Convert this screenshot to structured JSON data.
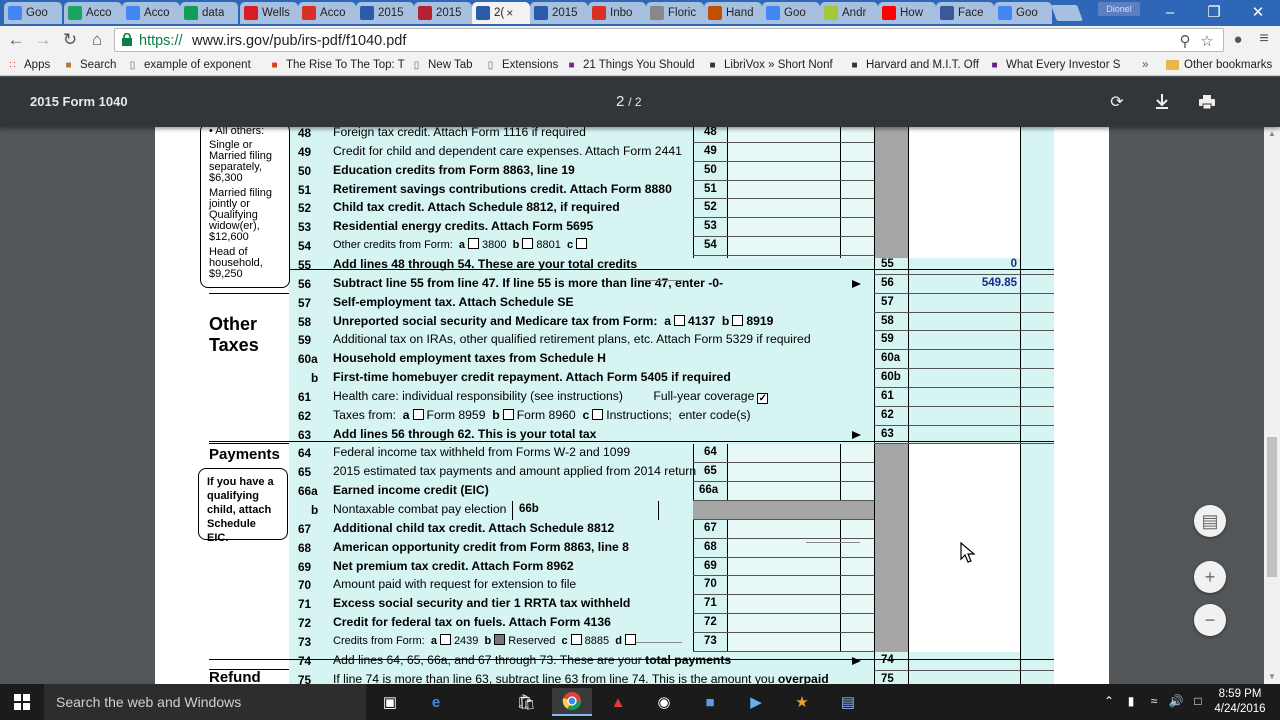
{
  "browser": {
    "tabs": [
      {
        "label": "Goo",
        "icon": "google-icon",
        "color": "#4285f4"
      },
      {
        "label": "Acco",
        "icon": "drive-icon",
        "color": "#1da462"
      },
      {
        "label": "Acco",
        "icon": "docs-icon",
        "color": "#4285f4"
      },
      {
        "label": "data",
        "icon": "sheets-icon",
        "color": "#0f9d58"
      },
      {
        "label": "Wells",
        "icon": "wellsfargo-icon",
        "color": "#d71e28"
      },
      {
        "label": "Acco",
        "icon": "pdf-icon",
        "color": "#d93025"
      },
      {
        "label": "2015",
        "icon": "irs-icon",
        "color": "#2a5bab"
      },
      {
        "label": "2015",
        "icon": "flag-icon",
        "color": "#b22234"
      },
      {
        "label": "2(",
        "icon": "irs-icon",
        "color": "#2a5bab",
        "active": true
      },
      {
        "label": "2015",
        "icon": "irs-icon",
        "color": "#2a5bab"
      },
      {
        "label": "Inbo",
        "icon": "gmail-icon",
        "color": "#d93025"
      },
      {
        "label": "Floric",
        "icon": "page-icon",
        "color": "#888888"
      },
      {
        "label": "Hand",
        "icon": "site-icon",
        "color": "#c05000"
      },
      {
        "label": "Goo",
        "icon": "google-icon",
        "color": "#4285f4"
      },
      {
        "label": "Andr",
        "icon": "android-icon",
        "color": "#a4c639"
      },
      {
        "label": "How",
        "icon": "youtube-icon",
        "color": "#ff0000"
      },
      {
        "label": "Face",
        "icon": "facebook-icon",
        "color": "#3b5998"
      },
      {
        "label": "Goo",
        "icon": "google-icon",
        "color": "#4285f4"
      }
    ],
    "active_tab_close": "×",
    "user_chip": "Dionel",
    "url_scheme": "https://",
    "url_rest": "www.irs.gov/pub/irs-pdf/f1040.pdf",
    "bookmarks": [
      {
        "label": "Apps",
        "icon": "apps-icon"
      },
      {
        "label": "Search",
        "icon": "search-bm-icon"
      },
      {
        "label": "example of exponent",
        "icon": "page-icon"
      },
      {
        "label": "The Rise To The Top: T",
        "icon": "rise-icon"
      },
      {
        "label": "New Tab",
        "icon": "page-icon"
      },
      {
        "label": "Extensions",
        "icon": "page-icon"
      },
      {
        "label": "21 Things You Should",
        "icon": "yahoo-icon"
      },
      {
        "label": "LibriVox » Short Nonf",
        "icon": "librivox-icon"
      },
      {
        "label": "Harvard and M.I.T. Off",
        "icon": "harvard-icon"
      },
      {
        "label": "What Every Investor S",
        "icon": "investor-icon"
      }
    ],
    "bookmarks_overflow": "»",
    "other_bookmarks": "Other bookmarks"
  },
  "pdf": {
    "title": "2015 Form 1040",
    "page_current": "2",
    "page_total": "2"
  },
  "form": {
    "sidebox_std": {
      "all_others": "• All others:",
      "single": "Single or Married filing separately, $6,300",
      "married": "Married filing jointly or Qualifying widow(er), $12,600",
      "head": "Head of household, $9,250"
    },
    "section_other_taxes": "Other Taxes",
    "section_payments": "Payments",
    "section_refund": "Refund",
    "sidebox_eic": "If you have a qualifying child, attach Schedule EIC.",
    "lines": [
      {
        "n": "48",
        "text": "Foreign tax credit. Attach Form 1116 if required",
        "box": "48"
      },
      {
        "n": "49",
        "text": "Credit for child and dependent care expenses. Attach Form 2441",
        "box": "49"
      },
      {
        "n": "50",
        "text": "Education credits from Form 8863, line 19",
        "box": "50"
      },
      {
        "n": "51",
        "text": "Retirement savings contributions credit. Attach Form 8880",
        "box": "51"
      },
      {
        "n": "52",
        "text": "Child tax credit. Attach Schedule 8812, if required",
        "box": "52"
      },
      {
        "n": "53",
        "text": "Residential energy credits. Attach Form 5695",
        "box": "53"
      },
      {
        "n": "54",
        "text": "Other credits from Form:",
        "a": "a",
        "a_val": "3800",
        "b": "b",
        "b_val": "8801",
        "c": "c",
        "box": "54"
      },
      {
        "n": "55",
        "text": "Add lines 48 through 54. These are your ",
        "bold": "total credits",
        "box": "55",
        "value": "0"
      },
      {
        "n": "56",
        "text": "Subtract line 55 from line 47. If line 55 is more than line 47, enter -0-",
        "box": "56",
        "value": "549.85"
      },
      {
        "n": "57",
        "text": "Self-employment tax. Attach Schedule SE",
        "box": "57"
      },
      {
        "n": "58",
        "text": "Unreported social security and Medicare tax from Form:",
        "a": "a",
        "a_val": "4137",
        "b": "b",
        "b_val": "8919",
        "box": "58"
      },
      {
        "n": "59",
        "text": "Additional tax on IRAs, other qualified retirement plans, etc. Attach Form 5329 if required",
        "box": "59"
      },
      {
        "n": "60a",
        "text": "Household employment taxes from Schedule H",
        "box": "60a"
      },
      {
        "n": "b",
        "text": "First-time homebuyer credit repayment. Attach Form 5405 if required",
        "box": "60b"
      },
      {
        "n": "61",
        "text": "Health care: individual responsibility (see instructions)",
        "extra": "Full-year coverage",
        "check": "✓",
        "box": "61"
      },
      {
        "n": "62",
        "text": "Taxes from:",
        "a": "a",
        "a_val": "Form 8959",
        "b": "b",
        "b_val": "Form 8960",
        "c": "c",
        "c_val": "Instructions;",
        "d_val": "enter code(s)",
        "box": "62"
      },
      {
        "n": "63",
        "text": "Add lines 56 through 62. This is your ",
        "bold": "total tax",
        "box": "63"
      },
      {
        "n": "64",
        "text": "Federal income tax withheld from Forms W-2 and 1099",
        "box": "64"
      },
      {
        "n": "65",
        "text": "2015 estimated tax payments and amount applied from 2014 return",
        "box": "65"
      },
      {
        "n": "66a",
        "text": "Earned income credit (EIC)",
        "box": "66a"
      },
      {
        "n": "b",
        "text": "Nontaxable combat pay election",
        "box": "66b"
      },
      {
        "n": "67",
        "text": "Additional child tax credit. Attach Schedule 8812",
        "box": "67"
      },
      {
        "n": "68",
        "text": "American opportunity credit from Form 8863, line 8",
        "box": "68"
      },
      {
        "n": "69",
        "text": "Net premium tax credit. Attach Form 8962",
        "box": "69"
      },
      {
        "n": "70",
        "text": "Amount paid with request for extension to file",
        "box": "70"
      },
      {
        "n": "71",
        "text": "Excess social security and tier 1 RRTA tax withheld",
        "box": "71"
      },
      {
        "n": "72",
        "text": "Credit for federal tax on fuels. Attach Form 4136",
        "box": "72"
      },
      {
        "n": "73",
        "text": "Credits from Form:",
        "a": "a",
        "a_val": "2439",
        "b": "b",
        "b_val": "Reserved",
        "c": "c",
        "c_val": "8885",
        "d": "d",
        "box": "73"
      },
      {
        "n": "74",
        "text": "Add lines 64, 65, 66a, and 67 through 73. These are your ",
        "bold": "total payments",
        "box": "74"
      },
      {
        "n": "75",
        "text": "If line 74 is more than line 63, subtract line 63 from line 74. This is the amount you ",
        "bold": "overpaid",
        "box": "75"
      }
    ]
  },
  "taskbar": {
    "search_placeholder": "Search the web and Windows",
    "time": "8:59 PM",
    "date": "4/24/2016"
  },
  "colors": {
    "form_teal": "#d6f4f2",
    "value_blue": "#1a2a8c",
    "pdf_toolbar": "#323639",
    "tabstrip": "#2e66b8"
  }
}
